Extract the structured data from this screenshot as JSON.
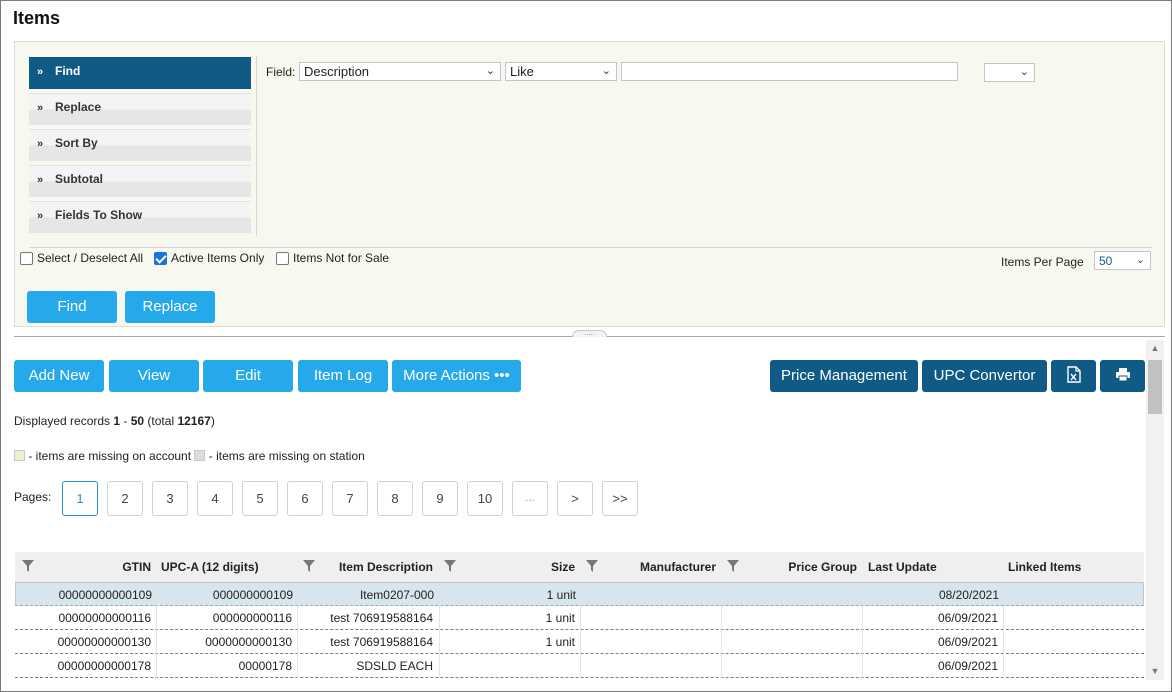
{
  "page": {
    "title": "Items"
  },
  "find_panel": {
    "menu": [
      {
        "label": "Find",
        "active": true
      },
      {
        "label": "Replace",
        "active": false
      },
      {
        "label": "Sort By",
        "active": false
      },
      {
        "label": "Subtotal",
        "active": false
      },
      {
        "label": "Fields To Show",
        "active": false
      }
    ],
    "field_label": "Field:",
    "field_select": "Description",
    "operator_select": "Like",
    "value_input": "",
    "extra_select": "",
    "select_all_label": "Select / Deselect All",
    "select_all_checked": false,
    "active_only_label": "Active Items Only",
    "active_only_checked": true,
    "not_for_sale_label": "Items Not for Sale",
    "not_for_sale_checked": false,
    "items_per_page_label": "Items Per Page",
    "items_per_page": "50",
    "find_button": "Find",
    "replace_button": "Replace"
  },
  "toolbar": {
    "add_new": "Add New",
    "view": "View",
    "edit": "Edit",
    "item_log": "Item Log",
    "more_actions": "More Actions •••",
    "price_management": "Price Management",
    "upc_convertor": "UPC Convertor"
  },
  "records": {
    "prefix": "Displayed records ",
    "from": "1",
    "sep": " - ",
    "to": "50",
    "total_prefix": " (total ",
    "total": "12167",
    "total_suffix": ")"
  },
  "legend": {
    "account_text": " - items are missing on account",
    "station_text": " - items are missing on station",
    "account_color": "#f1efd2",
    "station_color": "#dcdcdc"
  },
  "pagination": {
    "label": "Pages:",
    "pages": [
      "1",
      "2",
      "3",
      "4",
      "5",
      "6",
      "7",
      "8",
      "9",
      "10",
      "...",
      ">",
      ">>"
    ],
    "current": "1"
  },
  "table": {
    "headers": [
      "GTIN",
      "UPC-A (12 digits)",
      "Item Description",
      "Size",
      "Manufacturer",
      "Price Group",
      "Last Update",
      "Linked Items"
    ],
    "rows": [
      {
        "gtin": "00000000000109",
        "upca": "000000000109",
        "desc": "Item0207-000",
        "size": "1 unit",
        "manufacturer": "",
        "price_group": "",
        "last_update": "08/20/2021",
        "linked": ""
      },
      {
        "gtin": "00000000000116",
        "upca": "000000000116",
        "desc": "test 706919588164",
        "size": "1 unit",
        "manufacturer": "",
        "price_group": "",
        "last_update": "06/09/2021",
        "linked": ""
      },
      {
        "gtin": "00000000000130",
        "upca": "0000000000130",
        "desc": "test 706919588164",
        "size": "1 unit",
        "manufacturer": "",
        "price_group": "",
        "last_update": "06/09/2021",
        "linked": ""
      },
      {
        "gtin": "00000000000178",
        "upca": "00000178",
        "desc": "SDSLD EACH",
        "size": "",
        "manufacturer": "",
        "price_group": "",
        "last_update": "06/09/2021",
        "linked": ""
      }
    ]
  },
  "colors": {
    "primary_button": "#26a9eb",
    "dark_button": "#0f5b86",
    "selected_row": "#d7e5ee",
    "panel_bg": "#f7f9f1"
  }
}
